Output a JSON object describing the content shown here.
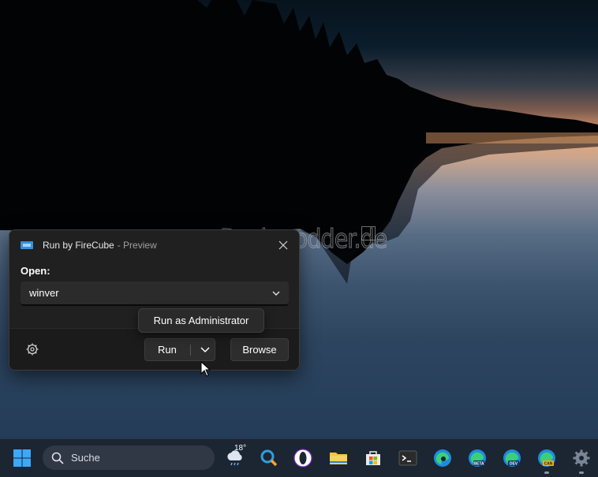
{
  "watermark": "Deskmodder.de",
  "dialog": {
    "title": "Run by FireCube",
    "title_suffix": "- Preview",
    "open_label": "Open:",
    "input_value": "winver",
    "run_label": "Run",
    "browse_label": "Browse",
    "tooltip": "Run as Administrator"
  },
  "taskbar": {
    "search_placeholder": "Suche",
    "weather_temp": "18°",
    "apps": [
      "windows-start",
      "search",
      "weather",
      "everything-search",
      "opera",
      "file-explorer",
      "microsoft-store",
      "terminal",
      "edge",
      "edge-beta",
      "edge-dev",
      "edge-canary",
      "settings"
    ],
    "edge_badges": [
      "BETA",
      "DEV",
      "CAN"
    ]
  },
  "colors": {
    "dialog_bg": "#202020",
    "taskbar_bg": "#1c2532",
    "accent": "#0078d4"
  }
}
